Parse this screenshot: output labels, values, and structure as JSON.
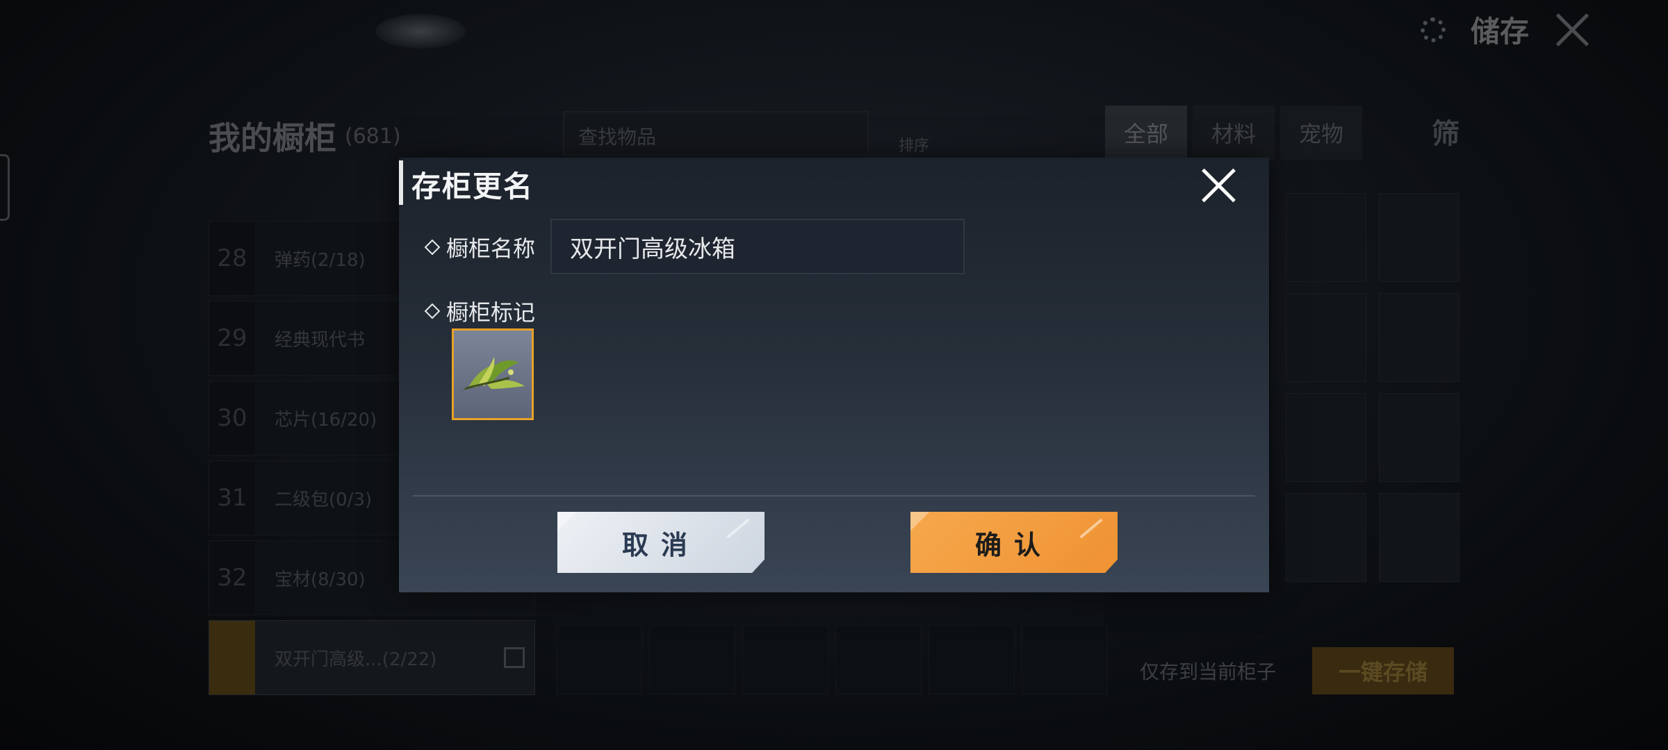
{
  "background": {
    "top_right": {
      "title": "储存"
    },
    "locker": {
      "title": "我的橱柜",
      "count": "(681)",
      "search_placeholder": "查找物品",
      "sort_label": "排序"
    },
    "category_tabs": [
      "全部",
      "材料",
      "宠物"
    ],
    "category_filter": "筛",
    "locker_rows": [
      {
        "num": "28",
        "name": "弹药(2/18)"
      },
      {
        "num": "29",
        "name": "经典现代书"
      },
      {
        "num": "30",
        "name": "芯片(16/20)"
      },
      {
        "num": "31",
        "name": "二级包(0/3)"
      },
      {
        "num": "32",
        "name": "宝材(8/30)"
      },
      {
        "num": "",
        "name": "双开门高级...(2/22)"
      }
    ],
    "bottom": {
      "only_save_label": "仅存到当前柜子",
      "one_click_label": "一键存储"
    }
  },
  "dialog": {
    "title": "存柜更名",
    "name_label": "橱柜名称",
    "name_value": "双开门高级冰箱",
    "mark_label": "橱柜标记",
    "mark_icon": "green-plant-icon",
    "cancel_label": "取消",
    "confirm_label": "确认",
    "colors": {
      "confirm": "#ef9233",
      "cancel": "#dfe5ec",
      "selected_border": "#e9a229"
    }
  }
}
